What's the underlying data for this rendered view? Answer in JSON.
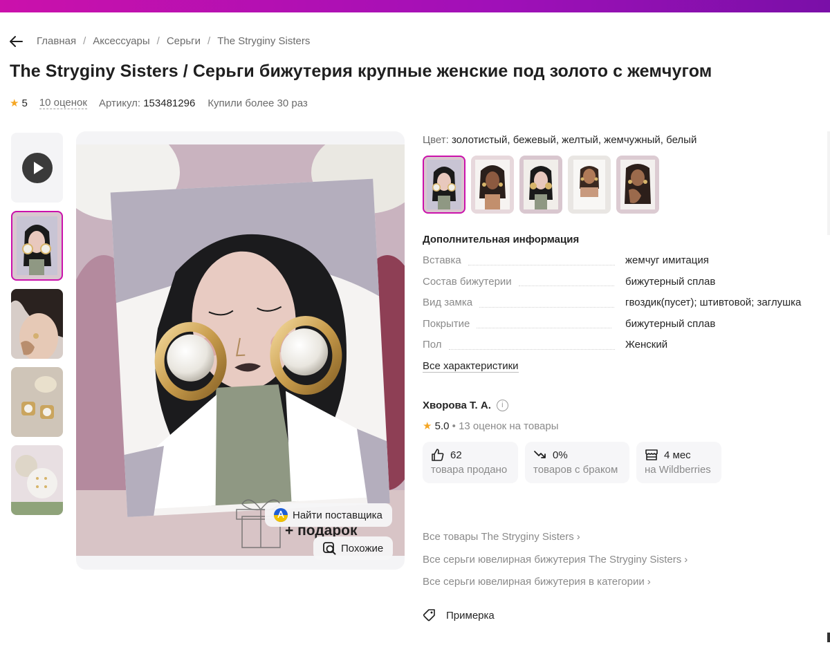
{
  "breadcrumbs": [
    "Главная",
    "Аксессуары",
    "Серьги",
    "The Stryginy Sisters"
  ],
  "product": {
    "title": "The Stryginy Sisters / Серьги бижутерия крупные женские под золото с жемчугом",
    "rating": "5",
    "reviews": "10 оценок",
    "article_label": "Артикул:",
    "article": "153481296",
    "purchased": "Купили более 30 раз"
  },
  "gallery": {
    "overlay_gift": "+ подарок",
    "find_supplier": "Найти поставщика",
    "similar": "Похожие"
  },
  "color": {
    "label": "Цвет:",
    "value": "золотистый, бежевый, желтый, жемчужный, белый"
  },
  "additional_info": {
    "heading": "Дополнительная информация",
    "rows": [
      {
        "key": "Вставка",
        "value": "жемчуг имитация"
      },
      {
        "key": "Состав бижутерии",
        "value": "бижутерный сплав"
      },
      {
        "key": "Вид замка",
        "value": "гвоздик(пусет); штивтовой; заглушка"
      },
      {
        "key": "Покрытие",
        "value": "бижутерный сплав"
      },
      {
        "key": "Пол",
        "value": "Женский"
      }
    ],
    "all_specs": "Все характеристики"
  },
  "seller": {
    "name": "Хворова Т. А.",
    "rating": "5.0",
    "rating_text": "• 13 оценок на товары",
    "stats": [
      {
        "value": "62",
        "label": "товара продано",
        "icon": "thumbs-up-icon"
      },
      {
        "value": "0%",
        "label": "товаров с браком",
        "icon": "trend-down-icon"
      },
      {
        "value": "4 мес",
        "label": "на Wildberries",
        "icon": "store-icon"
      }
    ]
  },
  "links": [
    "Все товары The Stryginy Sisters",
    "Все серьги ювелирная бижутерия The Stryginy Sisters",
    "Все серьги ювелирная бижутерия в категории"
  ],
  "try_on": "Примерка",
  "colors": {
    "accent": "#cb11ab",
    "star": "#f5a623"
  }
}
